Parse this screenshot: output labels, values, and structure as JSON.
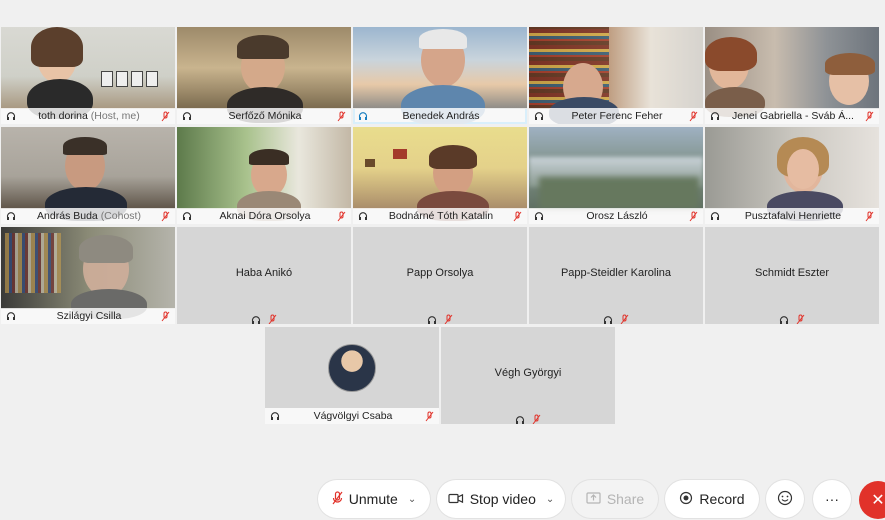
{
  "participants": [
    {
      "name": "toth dorina",
      "role": "(Host, me)",
      "muted": true
    },
    {
      "name": "Serfőző Mónika",
      "role": "",
      "muted": true
    },
    {
      "name": "Benedek András",
      "role": "",
      "muted": false
    },
    {
      "name": "Peter Ferenc Feher",
      "role": "",
      "muted": true
    },
    {
      "name": "Jenei Gabriella - Sváb Á...",
      "role": "",
      "muted": true
    },
    {
      "name": "András Buda",
      "role": "(Cohost)",
      "muted": true
    },
    {
      "name": "Aknai Dóra Orsolya",
      "role": "",
      "muted": true
    },
    {
      "name": "Bodnárné Tóth Katalin",
      "role": "",
      "muted": true
    },
    {
      "name": "Orosz László",
      "role": "",
      "muted": true
    },
    {
      "name": "Pusztafalvi Henriette",
      "role": "",
      "muted": true
    },
    {
      "name": "Szilágyi Csilla",
      "role": "",
      "muted": true
    },
    {
      "name": "Haba Anikó",
      "role": "",
      "muted": true
    },
    {
      "name": "Papp Orsolya",
      "role": "",
      "muted": true
    },
    {
      "name": "Papp-Steidler Karolina",
      "role": "",
      "muted": true
    },
    {
      "name": "Schmidt Eszter",
      "role": "",
      "muted": true
    },
    {
      "name": "Vágvölgyi Csaba",
      "role": "",
      "muted": true
    },
    {
      "name": "Végh Györgyi",
      "role": "",
      "muted": true
    }
  ],
  "toolbar": {
    "unmute": "Unmute",
    "stop_video": "Stop video",
    "share": "Share",
    "record": "Record",
    "more": "···"
  },
  "colors": {
    "active_border": "#2ea8e6",
    "mute_red": "#e1322a",
    "end_button": "#e1322a"
  }
}
